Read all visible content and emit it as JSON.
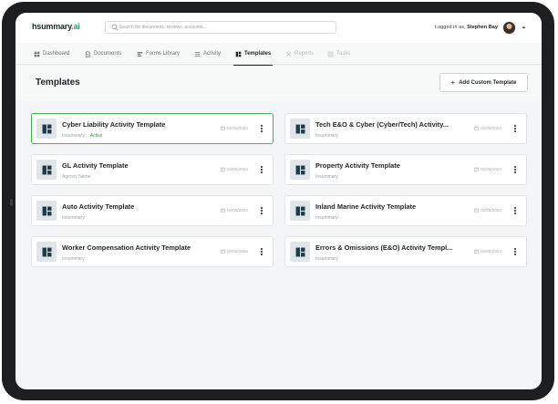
{
  "app": {
    "logo_text": "hsummary",
    "logo_dot": ".ai",
    "search_placeholder": "Search for documents, reviews, accounts...",
    "logged_in_prefix": "Logged in as,",
    "user_name": "Stephen Bay"
  },
  "nav": [
    {
      "label": "Dashboard",
      "icon": "dashboard-icon",
      "state": "normal"
    },
    {
      "label": "Documents",
      "icon": "document-icon",
      "state": "normal"
    },
    {
      "label": "Forms Library",
      "icon": "forms-icon",
      "state": "normal"
    },
    {
      "label": "Activity",
      "icon": "activity-icon",
      "state": "normal"
    },
    {
      "label": "Templates",
      "icon": "template-icon",
      "state": "active"
    },
    {
      "label": "Reports",
      "icon": "reports-icon",
      "state": "disabled"
    },
    {
      "label": "Tasks",
      "icon": "tasks-icon",
      "state": "disabled"
    }
  ],
  "page": {
    "title": "Templates",
    "add_button_label": "Add Custom Template"
  },
  "templates": [
    {
      "name": "Cyber Liability Activity Template",
      "source": "Insummary",
      "status": "Active",
      "date": "02/05/2024",
      "selected": true
    },
    {
      "name": "Tech E&O & Cyber (Cyber/Tech) Activity...",
      "source": "Insummary",
      "status": "",
      "date": "02/05/2024",
      "selected": false
    },
    {
      "name": "GL Activity Template",
      "source": "Agency Name",
      "status": "",
      "date": "02/05/2024",
      "selected": false
    },
    {
      "name": "Property Activity Template",
      "source": "Insummary",
      "status": "",
      "date": "02/05/2024",
      "selected": false
    },
    {
      "name": "Auto Activity Template",
      "source": "Insummary",
      "status": "",
      "date": "02/05/2024",
      "selected": false
    },
    {
      "name": "Inland Marine Activity Template",
      "source": "Insummary",
      "status": "",
      "date": "02/05/2024",
      "selected": false
    },
    {
      "name": "Worker Compensation Activity Template",
      "source": "Insummary",
      "status": "",
      "date": "02/05/2024",
      "selected": false
    },
    {
      "name": "Errors & Omissions (E&O) Activity Templ...",
      "source": "Insummary",
      "status": "",
      "date": "02/05/2024",
      "selected": false
    }
  ],
  "colors": {
    "accent_active": "#4caf50",
    "status_green": "#2e9f4f",
    "tile_bg": "#dfe5e9",
    "icon_dark": "#1e3a4a"
  }
}
